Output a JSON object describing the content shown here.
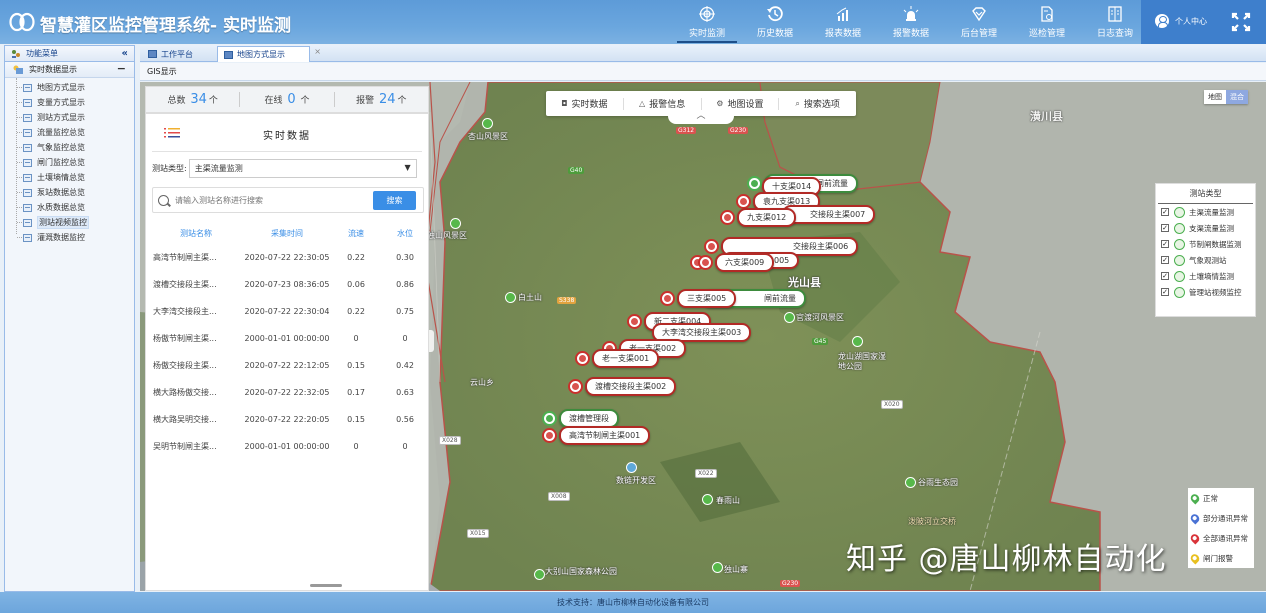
{
  "header": {
    "title": "智慧灌区监控管理系统- 实时监测",
    "nav": [
      {
        "label": "实时监测",
        "icon": "target-icon",
        "active": true
      },
      {
        "label": "历史数据",
        "icon": "history-icon"
      },
      {
        "label": "报表数据",
        "icon": "report-chart-icon"
      },
      {
        "label": "报警数据",
        "icon": "alarm-light-icon"
      },
      {
        "label": "后台管理",
        "icon": "diamond-icon"
      },
      {
        "label": "巡检管理",
        "icon": "inspection-doc-icon"
      },
      {
        "label": "日志查询",
        "icon": "log-book-icon"
      }
    ],
    "user_label": "个人中心"
  },
  "sidebar": {
    "title": "功能菜单",
    "collapse_label": "«",
    "group": "实时数据显示",
    "group_toggle": "−",
    "items": [
      {
        "label": "地图方式显示"
      },
      {
        "label": "变量方式显示"
      },
      {
        "label": "测站方式显示"
      },
      {
        "label": "流量监控总览"
      },
      {
        "label": "气象监控总览"
      },
      {
        "label": "闸门监控总览"
      },
      {
        "label": "土壤墒情总览"
      },
      {
        "label": "泵站数据总览"
      },
      {
        "label": "水质数据总览"
      },
      {
        "label": "测站视频监控",
        "selected": true
      },
      {
        "label": "灌溉数据监控"
      }
    ]
  },
  "tabs": [
    {
      "label": "工作平台"
    },
    {
      "label": "地图方式显示",
      "active": true,
      "close": "×"
    }
  ],
  "breadcrumb": "GIS显示",
  "stats": {
    "total_label": "总数",
    "total_value": "34",
    "total_unit": "个",
    "online_label": "在线",
    "online_value": "0",
    "online_unit": "个",
    "alarm_label": "报警",
    "alarm_value": "24",
    "alarm_unit": "个"
  },
  "panel": {
    "title": "实时数据",
    "type_label": "测站类型:",
    "type_value": "主渠流量监测",
    "search_placeholder": "请输入测站名称进行搜索",
    "search_button": "搜索",
    "columns": [
      "测站名称",
      "采集时间",
      "流速",
      "水位"
    ],
    "rows": [
      [
        "高湾节制闸主渠...",
        "2020-07-22 22:30:05",
        "0.22",
        "0.30"
      ],
      [
        "渡槽交接段主渠...",
        "2020-07-23 08:36:05",
        "0.06",
        "0.86"
      ],
      [
        "大李湾交接段主...",
        "2020-07-22 22:30:04",
        "0.22",
        "0.75"
      ],
      [
        "杨傲节制闸主渠...",
        "2000-01-01 00:00:00",
        "0",
        "0"
      ],
      [
        "杨傲交接段主渠...",
        "2020-07-22 22:12:05",
        "0.15",
        "0.42"
      ],
      [
        "横大路杨傲交接...",
        "2020-07-22 22:32:05",
        "0.17",
        "0.63"
      ],
      [
        "横大路吴明交接...",
        "2020-07-22 22:20:05",
        "0.15",
        "0.56"
      ],
      [
        "吴明节制闸主渠...",
        "2000-01-01 00:00:00",
        "0",
        "0"
      ]
    ]
  },
  "map_toolbar": [
    {
      "label": "实时数据",
      "icon": "data-icon"
    },
    {
      "label": "报警信息",
      "icon": "bell-icon"
    },
    {
      "label": "地图设置",
      "icon": "settings-icon"
    },
    {
      "label": "搜索选项",
      "icon": "search-icon"
    }
  ],
  "map_type": {
    "map": "地图",
    "hybrid": "混合"
  },
  "station_types": {
    "title": "测站类型",
    "items": [
      "主渠流量监测",
      "支渠流量监测",
      "节制闸数据监测",
      "气象观测站",
      "土壤墒情监测",
      "管理站视频监控"
    ]
  },
  "status_legend": [
    {
      "label": "正常",
      "color": "#4caf50"
    },
    {
      "label": "部分通讯异常",
      "color": "#4a72d4"
    },
    {
      "label": "全部通讯异常",
      "color": "#d9343a"
    },
    {
      "label": "闸门报警",
      "color": "#e8c020"
    }
  ],
  "markers": [
    {
      "label": "十支渠014",
      "type": "red"
    },
    {
      "label": "闸前流量",
      "type": "green"
    },
    {
      "label": "袁九支渠013",
      "type": "red"
    },
    {
      "label": "九支渠012",
      "type": "red"
    },
    {
      "label": "交接段主渠007",
      "type": "red"
    },
    {
      "label": "交接段主渠006",
      "type": "red"
    },
    {
      "label": "六支渠009",
      "type": "red"
    },
    {
      "label": "005",
      "type": "red"
    },
    {
      "label": "三支渠005",
      "type": "red"
    },
    {
      "label": "闸前流量",
      "type": "green"
    },
    {
      "label": "新二支渠004",
      "type": "red"
    },
    {
      "label": "大李湾交接段主渠003",
      "type": "red"
    },
    {
      "label": "老一支渠002",
      "type": "red"
    },
    {
      "label": "老一支渠001",
      "type": "red"
    },
    {
      "label": "渡槽交接段主渠002",
      "type": "red"
    },
    {
      "label": "渡槽管理段",
      "type": "green"
    },
    {
      "label": "高湾节制闸主渠001",
      "type": "red"
    }
  ],
  "places": {
    "xiangshan": "杏山风景区",
    "dushan": "独山风景区",
    "baitushan": "白土山",
    "yunshan": "云山乡",
    "huangchuan": "潢川县",
    "guangshan": "光山县",
    "guandu": "官渡河风景区",
    "longshan": "龙山湖国家湿地公园",
    "shuiyun": "数链开发区",
    "yuanyi": "谷雨生态园",
    "pilin": "泼陂河立交桥",
    "dashan": "大别山国家森林公园",
    "dushan2": "独山寨",
    "chunshan": "春雨山"
  },
  "roads": [
    "G312",
    "G230",
    "G40",
    "S338",
    "G45",
    "X028",
    "X020",
    "X022",
    "X008",
    "X015",
    "G230"
  ],
  "watermark": "知乎 @唐山柳林自动化",
  "footer": "技术支持：唐山市柳林自动化设备有限公司"
}
